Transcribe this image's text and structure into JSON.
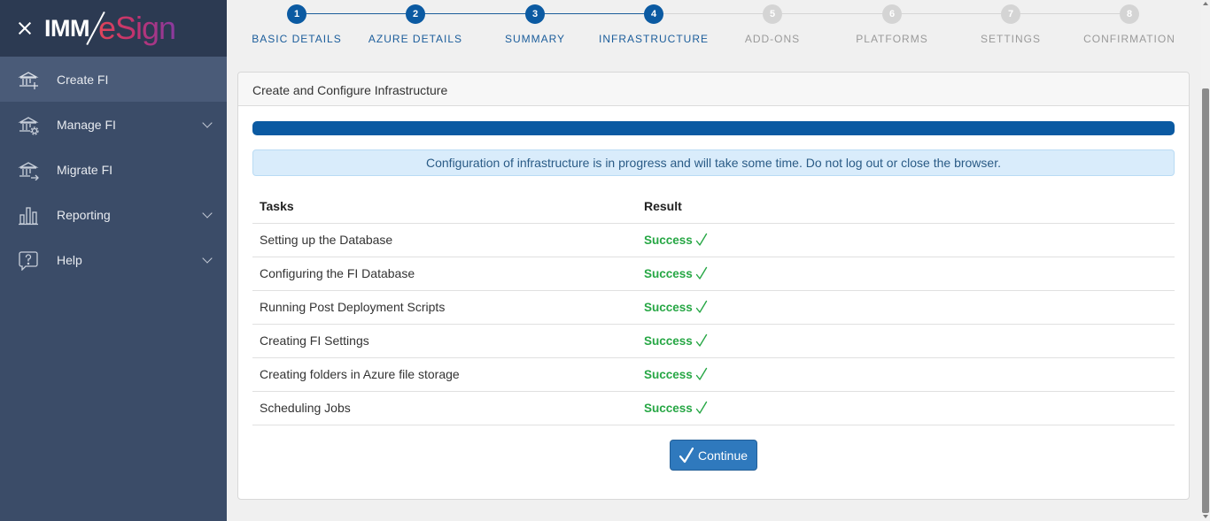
{
  "brand": {
    "part1": "IMM",
    "part2": "eSign"
  },
  "sidebar": {
    "items": [
      {
        "label": "Create FI",
        "icon": "bank-plus-icon",
        "active": true,
        "expandable": false
      },
      {
        "label": "Manage FI",
        "icon": "bank-gear-icon",
        "active": false,
        "expandable": true
      },
      {
        "label": "Migrate FI",
        "icon": "bank-arrow-icon",
        "active": false,
        "expandable": false
      },
      {
        "label": "Reporting",
        "icon": "bar-chart-icon",
        "active": false,
        "expandable": true
      },
      {
        "label": "Help",
        "icon": "help-bubble-icon",
        "active": false,
        "expandable": true
      }
    ]
  },
  "stepper": {
    "steps": [
      {
        "num": "1",
        "label": "BASIC DETAILS",
        "done": true
      },
      {
        "num": "2",
        "label": "AZURE DETAILS",
        "done": true
      },
      {
        "num": "3",
        "label": "SUMMARY",
        "done": true
      },
      {
        "num": "4",
        "label": "INFRASTRUCTURE",
        "done": true
      },
      {
        "num": "5",
        "label": "ADD-ONS",
        "done": false
      },
      {
        "num": "6",
        "label": "PLATFORMS",
        "done": false
      },
      {
        "num": "7",
        "label": "SETTINGS",
        "done": false
      },
      {
        "num": "8",
        "label": "CONFIRMATION",
        "done": false
      }
    ]
  },
  "card": {
    "title": "Create and Configure Infrastructure",
    "progress_percent": 100,
    "alert": "Configuration of infrastructure is in progress and will take some time. Do not log out or close the browser.",
    "columns": {
      "tasks": "Tasks",
      "result": "Result"
    },
    "rows": [
      {
        "task": "Setting up the Database",
        "result": "Success"
      },
      {
        "task": "Configuring the FI Database",
        "result": "Success"
      },
      {
        "task": "Running Post Deployment Scripts",
        "result": "Success"
      },
      {
        "task": "Creating FI Settings",
        "result": "Success"
      },
      {
        "task": "Creating folders in Azure file storage",
        "result": "Success"
      },
      {
        "task": "Scheduling Jobs",
        "result": "Success"
      }
    ],
    "continue_label": "Continue"
  },
  "colors": {
    "sidebar_bg": "#3b4c68",
    "sidebar_header_bg": "#2c3a52",
    "accent": "#0b5aa2",
    "success": "#27a745",
    "button": "#2f79bd"
  }
}
